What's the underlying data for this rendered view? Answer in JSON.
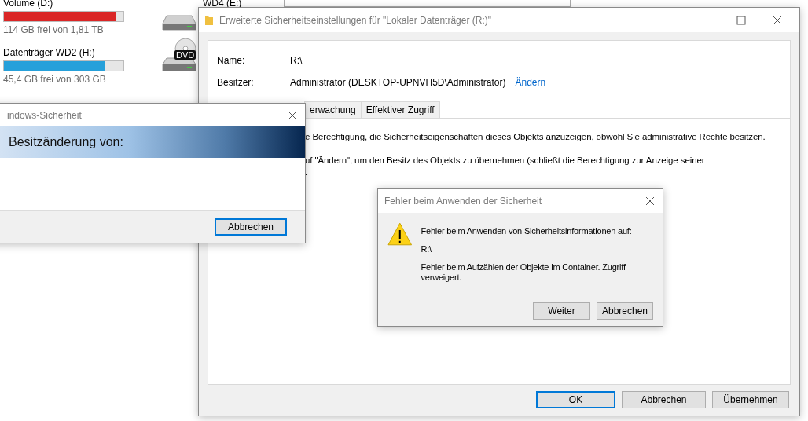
{
  "explorer": {
    "drives": [
      {
        "name": "Volume (D:)",
        "level": 0.94,
        "color": "#da2626",
        "free": "114 GB frei von 1,81 TB"
      },
      {
        "name": "Datenträger WD2 (H:)",
        "level": 0.85,
        "color": "#26a0da",
        "free": "45,4 GB frei von 303 GB"
      }
    ],
    "icons": [
      {
        "kind": "hdd"
      },
      {
        "kind": "dvd",
        "label": "DVD"
      }
    ],
    "top_labels": [
      "WD4 (E:)"
    ]
  },
  "security_window": {
    "title": "Erweiterte Sicherheitseinstellungen für \"Lokaler Datenträger (R:)\"",
    "fields": [
      {
        "label": "Name:",
        "value": "R:\\"
      },
      {
        "label": "Besitzer:",
        "value": "Administrator (DESKTOP-UPNVH5D\\Administrator)",
        "link": "Ändern"
      }
    ],
    "tabs": [
      {
        "label": "erwachung",
        "selected": false
      },
      {
        "label": "Effektiver Zugriff",
        "selected": false
      }
    ],
    "lines": [
      "e Berechtigung, die Sicherheitseigenschaften dieses Objekts anzuzeigen, obwohl Sie administrative Rechte besitzen.",
      "uf \"Ändern\", um den Besitz des Objekts zu übernehmen (schließt die Berechtigung zur Anzeige seiner",
      "."
    ],
    "buttons": [
      {
        "label": "OK",
        "focused": true
      },
      {
        "label": "Abbrechen",
        "focused": false
      },
      {
        "label": "Übernehmen",
        "focused": false
      }
    ]
  },
  "ownership_dialog": {
    "title": "indows-Sicherheit",
    "banner": "Besitzänderung von:",
    "buttons": [
      {
        "label": "Abbrechen",
        "focused": true
      }
    ]
  },
  "error_dialog": {
    "title": "Fehler beim Anwenden der Sicherheit",
    "message": "Fehler beim Anwenden von Sicherheitsinformationen auf:",
    "path": "R:\\",
    "detail": "Fehler beim Aufzählen der Objekte im Container. Zugriff verweigert.",
    "buttons": [
      {
        "label": "Weiter",
        "focused": false
      },
      {
        "label": "Abbrechen",
        "focused": false
      }
    ]
  }
}
